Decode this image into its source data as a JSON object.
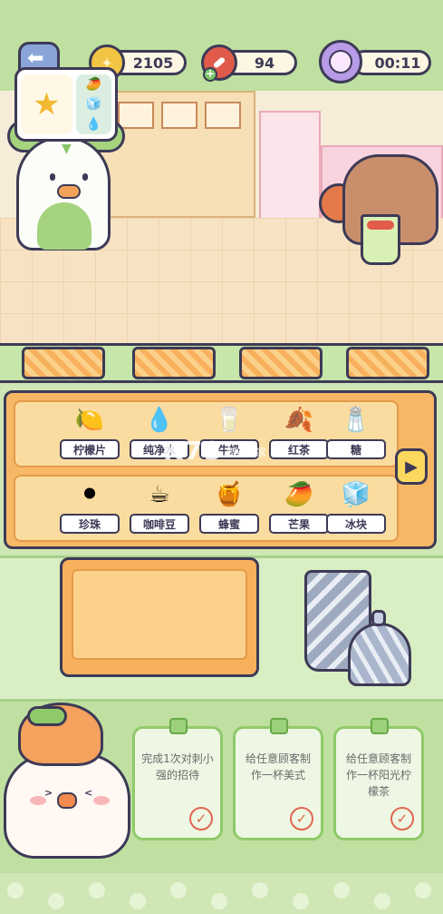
{
  "hud": {
    "back_label": "退出",
    "coins": "2105",
    "meat": "94",
    "timer": "00:11"
  },
  "order": {
    "main_icon": "mango-shaved-ice-icon",
    "side_icons": [
      "mango-icon",
      "ice-cube-icon",
      "water-bottle-icon"
    ]
  },
  "ingredients_row1": [
    {
      "label": "柠檬片",
      "icon": "lemon-slices-icon",
      "glyph": "🍋"
    },
    {
      "label": "纯净水",
      "icon": "water-bottle-icon",
      "glyph": "💧"
    },
    {
      "label": "牛奶",
      "icon": "milk-jug-icon",
      "glyph": "🥛"
    },
    {
      "label": "红茶",
      "icon": "black-tea-icon",
      "glyph": "🍂"
    },
    {
      "label": "糖",
      "icon": "sugar-jar-icon",
      "glyph": "🧂"
    }
  ],
  "ingredients_row2": [
    {
      "label": "珍珠",
      "icon": "tapioca-pearls-icon",
      "glyph": "⚫"
    },
    {
      "label": "咖啡豆",
      "icon": "coffee-beans-icon",
      "glyph": "☕"
    },
    {
      "label": "蜂蜜",
      "icon": "honey-jar-icon",
      "glyph": "🍯"
    },
    {
      "label": "芒果",
      "icon": "mango-icon",
      "glyph": "🥭"
    },
    {
      "label": "冰块",
      "icon": "ice-cube-icon",
      "glyph": "🧊"
    }
  ],
  "watermark": {
    "brand": "K73",
    "tagline": "游戏之家"
  },
  "tasks": [
    {
      "text": "完成1次对刺小强的招待"
    },
    {
      "text": "给任意顾客制作一杯美式"
    },
    {
      "text": "给任意顾客制作一杯阳光柠檬茶"
    }
  ],
  "colors": {
    "accent_orange": "#f7b866",
    "accent_green": "#bfe0a0",
    "outline": "#3d3a56"
  }
}
